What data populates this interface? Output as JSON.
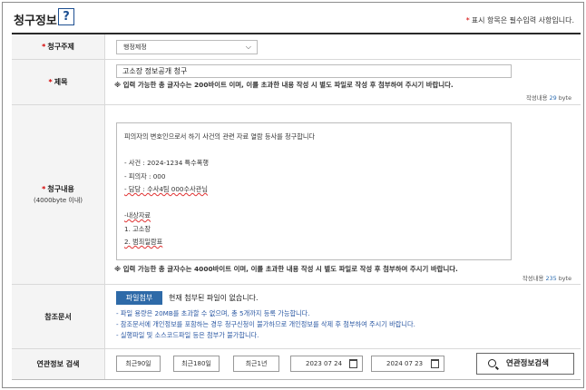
{
  "header": {
    "title": "청구정보",
    "help_icon": "?",
    "required_note": "표시 항목은 필수입력 사항입니다.",
    "required_star": "*"
  },
  "fields": {
    "agency": {
      "label": "청구주제",
      "value": "행정제정",
      "chevron": "⌵"
    },
    "subject": {
      "label": "제목",
      "value": "고소장 정보공개 청구",
      "note": "※ 입력 가능한 총 글자수는 200바이트 이며, 이를 초과한 내용 작성 시 별도 파일로 작성 후 첨부하여 주시기 바랍니다.",
      "bytes_prefix": "작성내용",
      "bytes_value": "29",
      "bytes_unit": "byte"
    },
    "content": {
      "label": "청구내용",
      "sublabel": "(4000byte 이내)",
      "lines": [
        "피의자의 변호인으로서 하기 사건의 관련 자료 열람 등사를 청구합니다",
        "",
        "- 사건 : 2024-1234 특수폭행",
        "- 피의자 : 000",
        "- 담당 : 수사4팀 000수사관님",
        "",
        "-내상자료",
        "1. 고소장",
        "2. 범죄일람표"
      ],
      "note": "※ 입력 가능한 총 글자수는 4000바이트 이며, 이를 초과한 내용 작성 시 별도 파일로 작성 후 첨부하여 주시기 바랍니다.",
      "bytes_prefix": "작성내용",
      "bytes_value": "235",
      "bytes_unit": "byte"
    },
    "attachment": {
      "label": "참조문서",
      "button": "파일첨부",
      "status": "현재 첨부된 파일이 없습니다.",
      "hints": [
        "- 파일 용량은 20MB를 초과할 수 없으며, 총 5개까지 등록 가능합니다.",
        "- 참조문서에 개인정보를 포함하는 경우 청구신청이 불가하므로 개인정보를 삭제 후 첨부하여 주시기 바랍니다.",
        "- 실행파일 및 소스코드파일 등은 첨부가 불가합니다."
      ]
    },
    "related": {
      "label": "연관정보 검색",
      "period_buttons": [
        "최근90일",
        "최근180일",
        "최근1년"
      ],
      "date_from": "2023 07 24",
      "date_to": "2024 07 23",
      "search_button": "연관정보검색"
    }
  }
}
